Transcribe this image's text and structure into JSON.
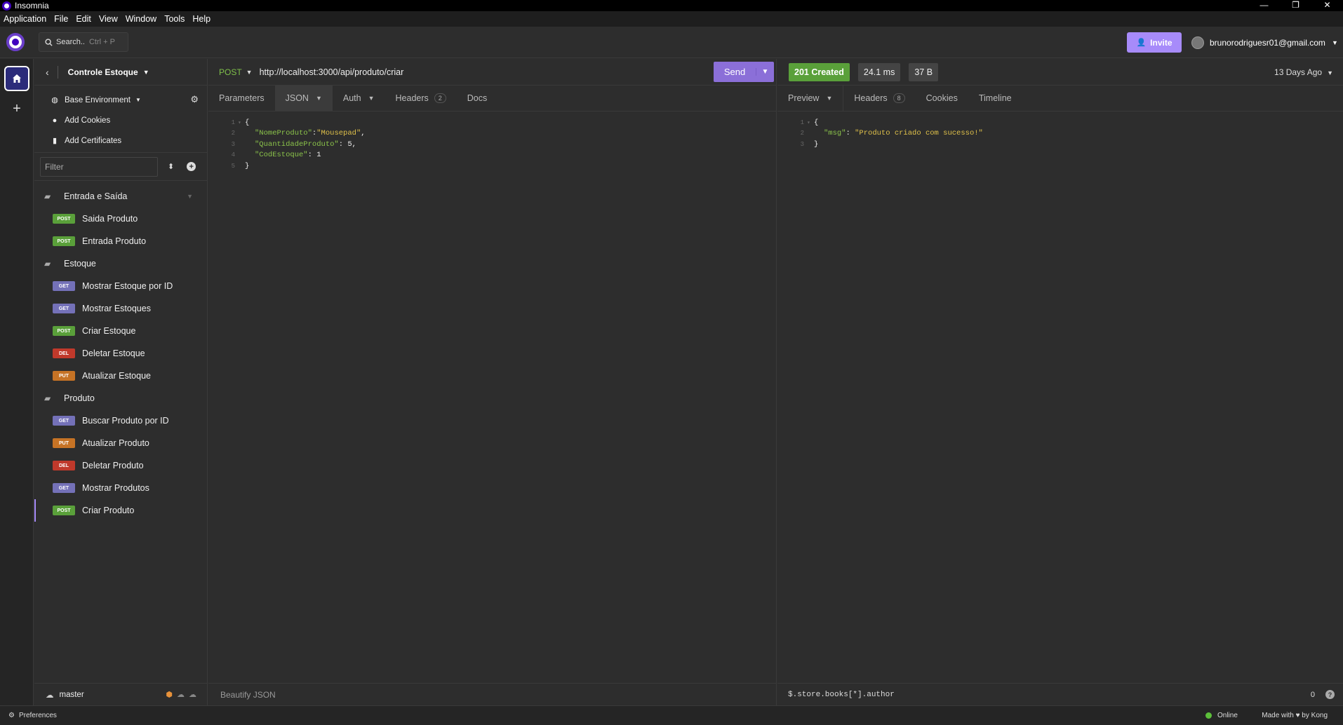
{
  "window": {
    "title": "Insomnia",
    "controls": [
      "—",
      "❐",
      "✕"
    ]
  },
  "menu": [
    "Application",
    "File",
    "Edit",
    "View",
    "Window",
    "Tools",
    "Help"
  ],
  "topbar": {
    "search_label": "Search..",
    "search_hint": "Ctrl + P",
    "invite_label": "Invite",
    "account_email": "brunorodriguesr01@gmail.com"
  },
  "sidebar": {
    "project": "Controle Estoque",
    "env": "Base Environment",
    "add_cookies": "Add Cookies",
    "add_certificates": "Add Certificates",
    "filter_placeholder": "Filter",
    "folders": [
      {
        "name": "Entrada e Saída",
        "requests": [
          {
            "method": "POST",
            "name": "Saida Produto"
          },
          {
            "method": "POST",
            "name": "Entrada Produto"
          }
        ]
      },
      {
        "name": "Estoque",
        "requests": [
          {
            "method": "GET",
            "name": "Mostrar Estoque por ID"
          },
          {
            "method": "GET",
            "name": "Mostrar Estoques"
          },
          {
            "method": "POST",
            "name": "Criar Estoque"
          },
          {
            "method": "DEL",
            "name": "Deletar Estoque"
          },
          {
            "method": "PUT",
            "name": "Atualizar Estoque"
          }
        ]
      },
      {
        "name": "Produto",
        "requests": [
          {
            "method": "GET",
            "name": "Buscar Produto por ID"
          },
          {
            "method": "PUT",
            "name": "Atualizar Produto"
          },
          {
            "method": "DEL",
            "name": "Deletar Produto"
          },
          {
            "method": "GET",
            "name": "Mostrar Produtos"
          },
          {
            "method": "POST",
            "name": "Criar Produto"
          }
        ]
      }
    ],
    "branch": "master"
  },
  "request": {
    "method": "POST",
    "url": "http://localhost:3000/api/produto/criar",
    "send_label": "Send",
    "tabs": {
      "parameters": "Parameters",
      "json": "JSON",
      "auth": "Auth",
      "headers": "Headers",
      "headers_count": "2",
      "docs": "Docs"
    },
    "body": {
      "l1": "{",
      "k1": "\"NomeProduto\"",
      "v1": "\"Mousepad\"",
      "k2": "\"QuantidadeProduto\"",
      "v2": "5",
      "k3": "\"CodEstoque\"",
      "v3": "1",
      "l5": "}"
    },
    "footer": "Beautify JSON"
  },
  "response": {
    "status": "201 Created",
    "time": "24.1 ms",
    "size": "37 B",
    "ago": "13 Days Ago",
    "tabs": {
      "preview": "Preview",
      "headers": "Headers",
      "headers_count": "8",
      "cookies": "Cookies",
      "timeline": "Timeline"
    },
    "body": {
      "l1": "{",
      "key": "\"msg\"",
      "value": "\"Produto criado com sucesso!\"",
      "l3": "}"
    },
    "filter": "$.store.books[*].author",
    "count": "0"
  },
  "statusbar": {
    "preferences": "Preferences",
    "online": "Online",
    "made_with": "Made with ♥ by Kong"
  },
  "colors": {
    "accent": "#a78bfa",
    "post": "#5aa03a",
    "get": "#7471b8",
    "del": "#c0392b",
    "put": "#c67325",
    "status_ok": "#5aa03a"
  }
}
